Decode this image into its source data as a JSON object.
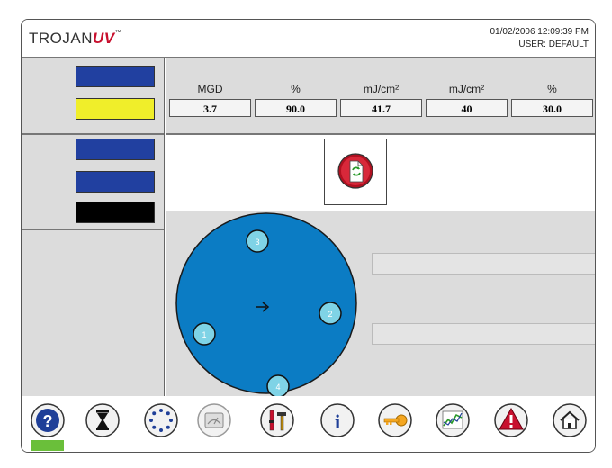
{
  "header": {
    "brand": "TROJAN",
    "brand_accent": "UV",
    "trademark": "™",
    "datetime": "01/02/2006 12:09:39 PM",
    "user": "USER:  DEFAULT"
  },
  "metrics": [
    {
      "unit": "MGD",
      "value": "3.7"
    },
    {
      "unit": "%",
      "value": "90.0"
    },
    {
      "unit": "mJ/cm²",
      "value": "41.7"
    },
    {
      "unit": "mJ/cm²",
      "value": "40"
    },
    {
      "unit": "%",
      "value": "30.0"
    }
  ],
  "lamp_channel": {
    "lamps": [
      {
        "label": "3"
      },
      {
        "label": "2"
      },
      {
        "label": "1"
      },
      {
        "label": "4"
      }
    ]
  },
  "toolbar": {
    "items": [
      {
        "name": "help-icon"
      },
      {
        "name": "hourglass-icon"
      },
      {
        "name": "lamp-ring-icon"
      },
      {
        "name": "gauge-icon"
      },
      {
        "name": "tools-icon"
      },
      {
        "name": "info-icon"
      },
      {
        "name": "key-icon"
      },
      {
        "name": "trend-chart-icon"
      },
      {
        "name": "alarm-warning-icon"
      },
      {
        "name": "home-icon"
      }
    ]
  },
  "colors": {
    "status_blue": "#2140a0",
    "status_yellow": "#f0ee2a",
    "status_black": "#000000",
    "channel_blue": "#0b7cc4",
    "lamp_fill": "#7fd3e6",
    "help_indicator": "#6abf3a",
    "alarm_red": "#c8102e"
  }
}
